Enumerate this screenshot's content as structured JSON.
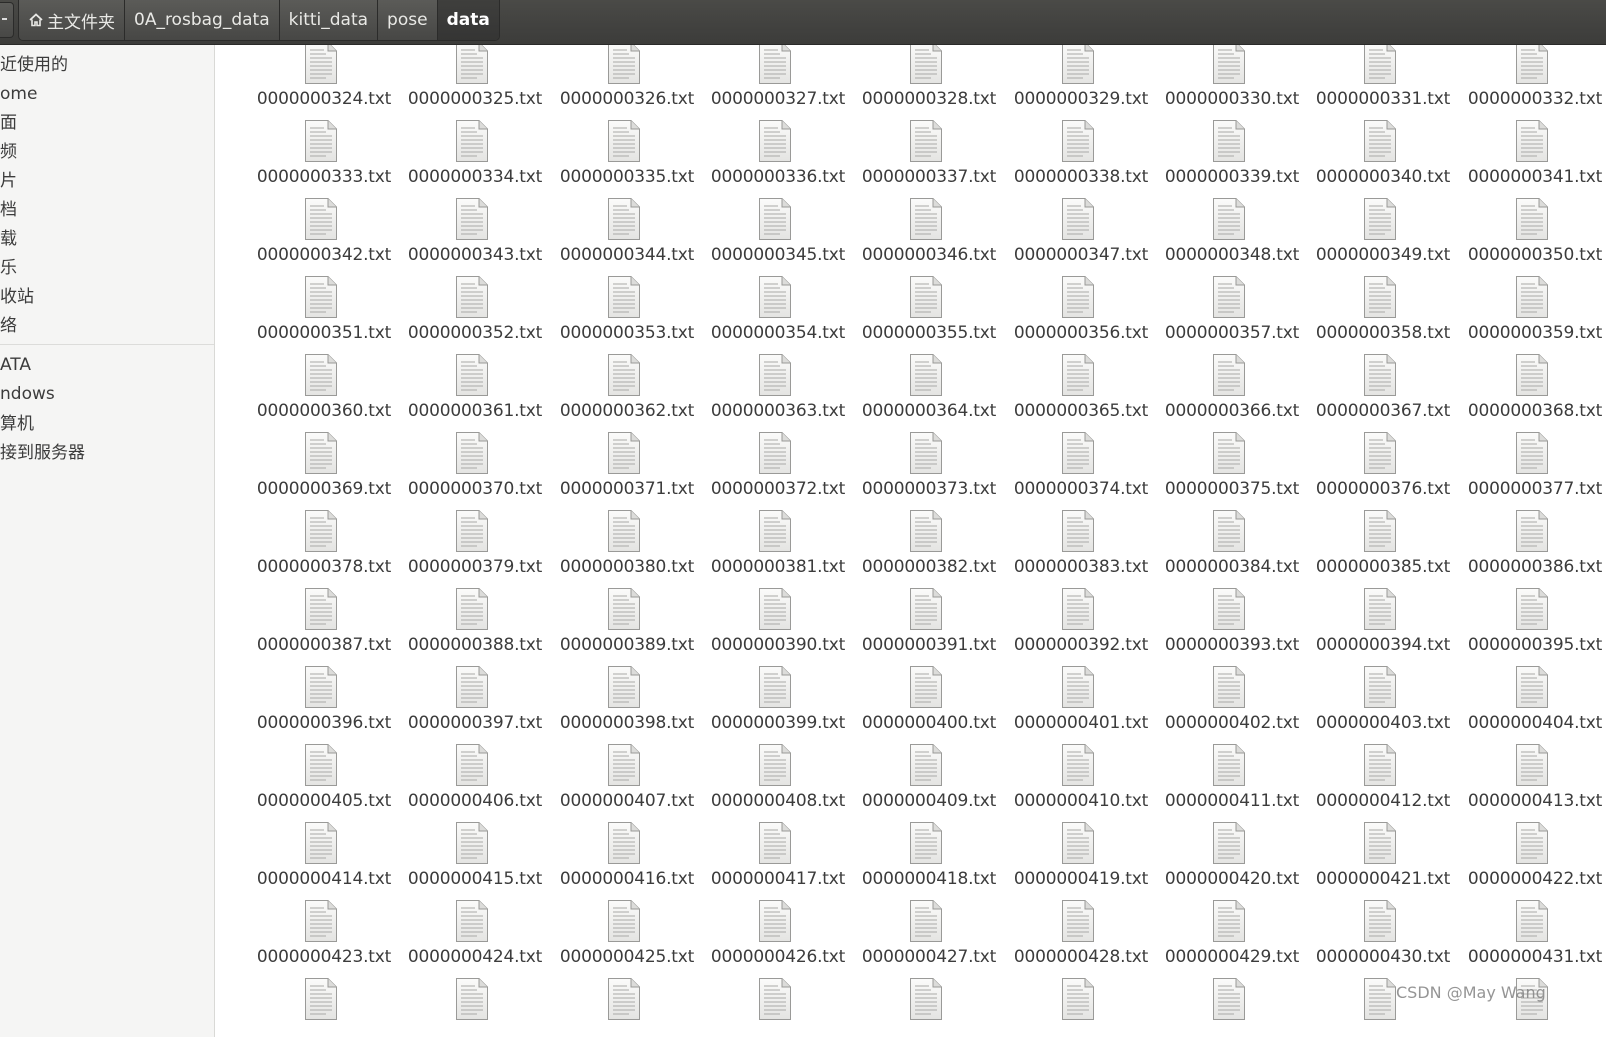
{
  "toolbar": {
    "breadcrumb": [
      {
        "label": "主文件夹",
        "icon": "home-icon"
      },
      {
        "label": "0A_rosbag_data"
      },
      {
        "label": "kitti_data"
      },
      {
        "label": "pose"
      },
      {
        "label": "data",
        "active": true
      }
    ]
  },
  "sidebar": {
    "groups": [
      [
        "近使用的",
        "ome",
        "面",
        "频",
        "片",
        "档",
        "载",
        "乐",
        "收站",
        "络"
      ],
      [
        "ATA",
        "ndows",
        "算机",
        "接到服务器"
      ]
    ]
  },
  "files": {
    "icon": "text-file-icon",
    "columns": 9,
    "visible_rows": 13,
    "first_number": 324,
    "last_labeled_number": 431,
    "name_prefix": "0000000",
    "extension": ".txt",
    "names": [
      "0000000324.txt",
      "0000000325.txt",
      "0000000326.txt",
      "0000000327.txt",
      "0000000328.txt",
      "0000000329.txt",
      "0000000330.txt",
      "0000000331.txt",
      "0000000332.txt",
      "0000000333.txt",
      "0000000334.txt",
      "0000000335.txt",
      "0000000336.txt",
      "0000000337.txt",
      "0000000338.txt",
      "0000000339.txt",
      "0000000340.txt",
      "0000000341.txt",
      "0000000342.txt",
      "0000000343.txt",
      "0000000344.txt",
      "0000000345.txt",
      "0000000346.txt",
      "0000000347.txt",
      "0000000348.txt",
      "0000000349.txt",
      "0000000350.txt",
      "0000000351.txt",
      "0000000352.txt",
      "0000000353.txt",
      "0000000354.txt",
      "0000000355.txt",
      "0000000356.txt",
      "0000000357.txt",
      "0000000358.txt",
      "0000000359.txt",
      "0000000360.txt",
      "0000000361.txt",
      "0000000362.txt",
      "0000000363.txt",
      "0000000364.txt",
      "0000000365.txt",
      "0000000366.txt",
      "0000000367.txt",
      "0000000368.txt",
      "0000000369.txt",
      "0000000370.txt",
      "0000000371.txt",
      "0000000372.txt",
      "0000000373.txt",
      "0000000374.txt",
      "0000000375.txt",
      "0000000376.txt",
      "0000000377.txt",
      "0000000378.txt",
      "0000000379.txt",
      "0000000380.txt",
      "0000000381.txt",
      "0000000382.txt",
      "0000000383.txt",
      "0000000384.txt",
      "0000000385.txt",
      "0000000386.txt",
      "0000000387.txt",
      "0000000388.txt",
      "0000000389.txt",
      "0000000390.txt",
      "0000000391.txt",
      "0000000392.txt",
      "0000000393.txt",
      "0000000394.txt",
      "0000000395.txt",
      "0000000396.txt",
      "0000000397.txt",
      "0000000398.txt",
      "0000000399.txt",
      "0000000400.txt",
      "0000000401.txt",
      "0000000402.txt",
      "0000000403.txt",
      "0000000404.txt",
      "0000000405.txt",
      "0000000406.txt",
      "0000000407.txt",
      "0000000408.txt",
      "0000000409.txt",
      "0000000410.txt",
      "0000000411.txt",
      "0000000412.txt",
      "0000000413.txt",
      "0000000414.txt",
      "0000000415.txt",
      "0000000416.txt",
      "0000000417.txt",
      "0000000418.txt",
      "0000000419.txt",
      "0000000420.txt",
      "0000000421.txt",
      "0000000422.txt",
      "0000000423.txt",
      "0000000424.txt",
      "0000000425.txt",
      "0000000426.txt",
      "0000000427.txt",
      "0000000428.txt",
      "0000000429.txt",
      "0000000430.txt",
      "0000000431.txt",
      "",
      "",
      "",
      "",
      "",
      "",
      "",
      "",
      ""
    ]
  },
  "watermark": "CSDN @May Wang"
}
